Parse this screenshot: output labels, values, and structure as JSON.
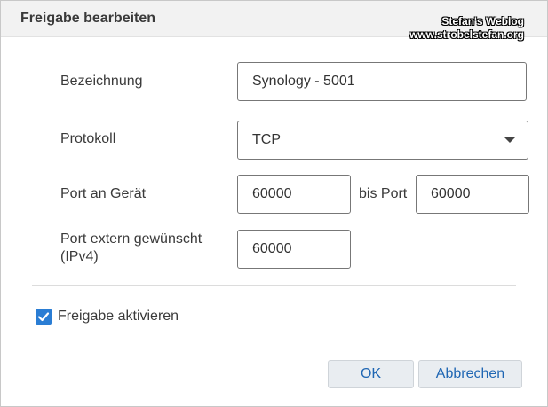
{
  "dialog": {
    "title": "Freigabe bearbeiten",
    "watermark_line1": "Stefan's Weblog",
    "watermark_line2": "www.strobelstefan.org"
  },
  "form": {
    "bezeichnung_label": "Bezeichnung",
    "bezeichnung_value": "Synology - 5001",
    "protokoll_label": "Protokoll",
    "protokoll_value": "TCP",
    "port_geraet_label": "Port an Gerät",
    "port_geraet_from": "60000",
    "bis_port_label": "bis Port",
    "port_geraet_to": "60000",
    "port_extern_label_line1": "Port extern gewünscht",
    "port_extern_label_line2": "(IPv4)",
    "port_extern_value": "60000",
    "freigabe_label": "Freigabe aktivieren",
    "freigabe_checked": true
  },
  "buttons": {
    "ok": "OK",
    "cancel": "Abbrechen"
  },
  "colors": {
    "accent": "#2a7dd4",
    "button_text": "#1f66b3"
  },
  "icons": {
    "dropdown": "chevron-down-icon",
    "checkbox": "checkmark-icon"
  }
}
